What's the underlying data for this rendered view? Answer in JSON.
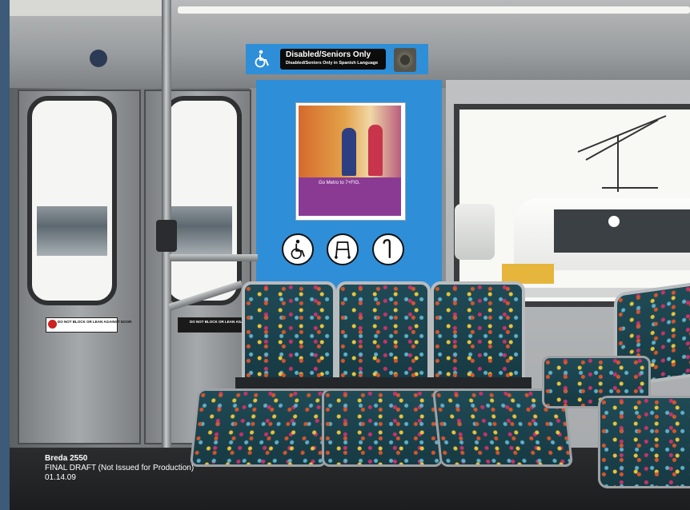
{
  "scene": {
    "description_label": "Breda 2550 train interior"
  },
  "sign": {
    "title": "Disabled/Seniors Only",
    "subtitle": "Disabled/Seniors Only in Spanish Language"
  },
  "poster": {
    "tagline": "Go Metro to 7+FIG."
  },
  "stickers": {
    "left_text": "DO NOT BLOCK OR LEAN AGAINST DOOR",
    "right_text": "DO NOT BLOCK OR LEAN AGAINST DOOR"
  },
  "caption": {
    "model": "Breda 2550",
    "status": "FINAL DRAFT (Not Issued for Production)",
    "date": "01.14.09"
  },
  "colors": {
    "panel_blue": "#2f8ed8",
    "frame_blue": "#3d5a78"
  },
  "icons": [
    "wheelchair-icon",
    "walker-icon",
    "cane-icon"
  ]
}
